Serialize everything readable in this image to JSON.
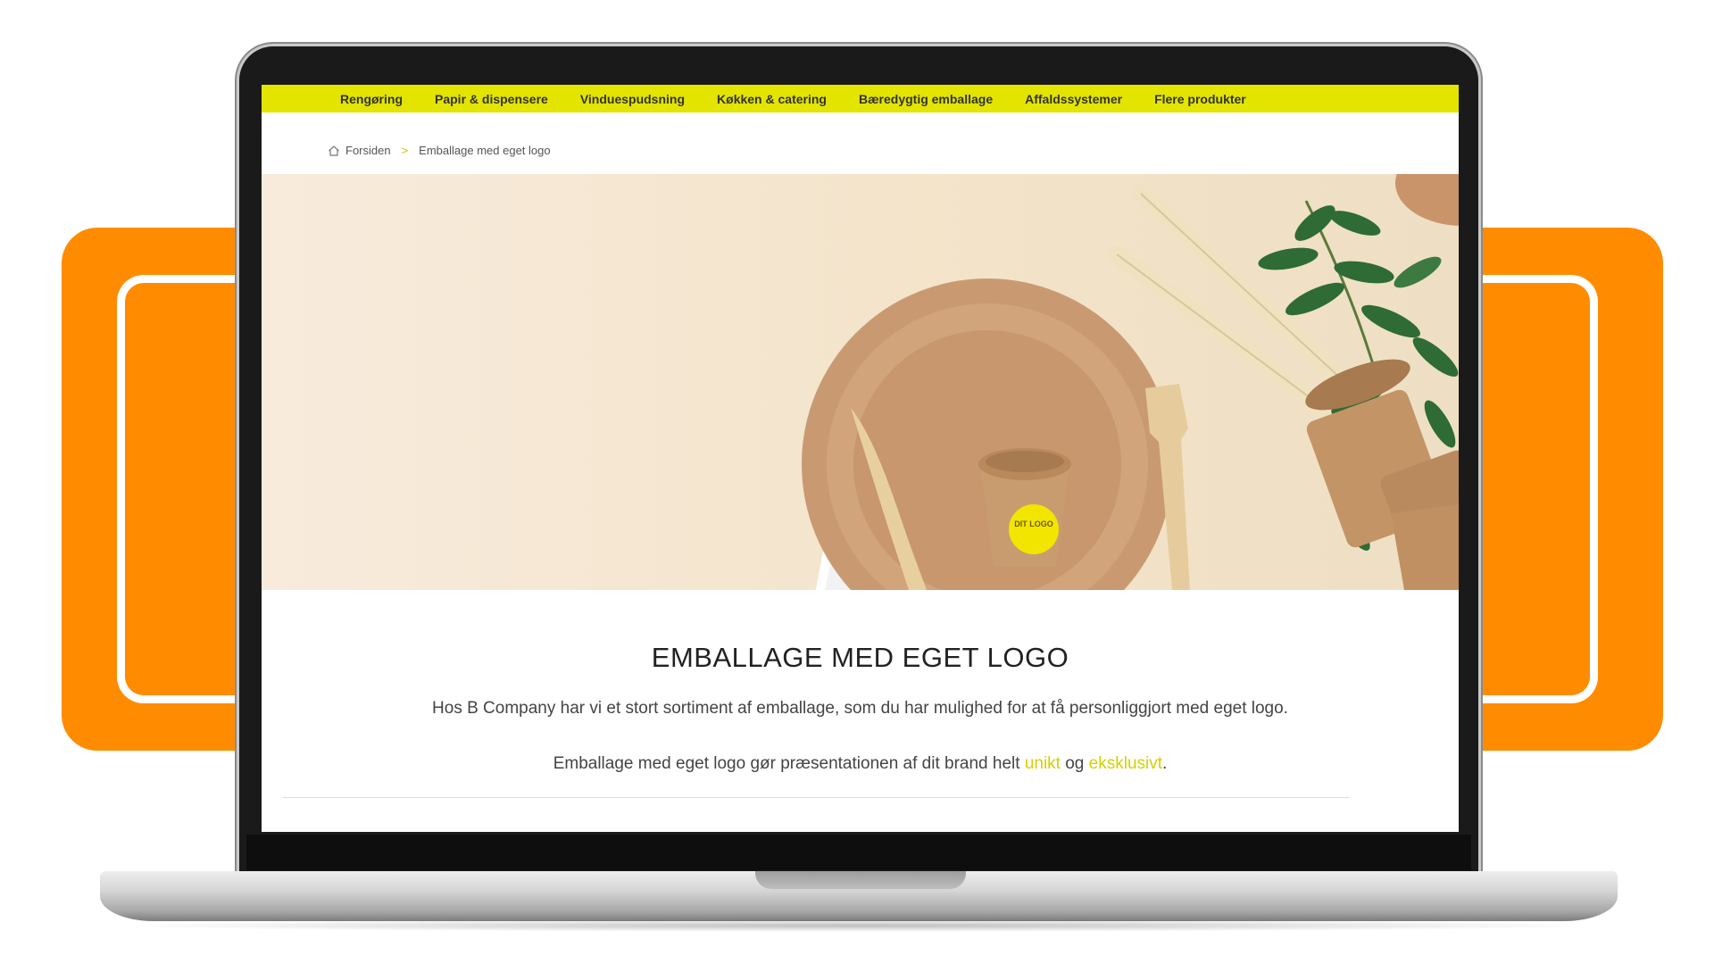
{
  "nav": {
    "items": [
      {
        "label": "Rengøring"
      },
      {
        "label": "Papir & dispensere"
      },
      {
        "label": "Vinduespudsning"
      },
      {
        "label": "Køkken & catering"
      },
      {
        "label": "Bæredygtig emballage"
      },
      {
        "label": "Affaldssystemer"
      },
      {
        "label": "Flere produkter"
      }
    ]
  },
  "breadcrumb": {
    "home": "Forsiden",
    "separator": ">",
    "current": "Emballage med eget logo"
  },
  "hero": {
    "sticker_text": "DIT LOGO"
  },
  "content": {
    "title": "EMBALLAGE MED EGET LOGO",
    "para1": "Hos B Company har vi et stort sortiment af emballage, som du har mulighed for at få personliggjort med eget logo.",
    "para2_prefix": "Emballage med eget logo gør præsentationen af dit brand helt ",
    "para2_link1": "unikt",
    "para2_mid": " og ",
    "para2_link2": "eksklusivt",
    "para2_suffix": "."
  },
  "colors": {
    "nav_bg": "#E3E400",
    "accent_orange": "#FF8C00",
    "link_yellow": "#D4D000"
  }
}
